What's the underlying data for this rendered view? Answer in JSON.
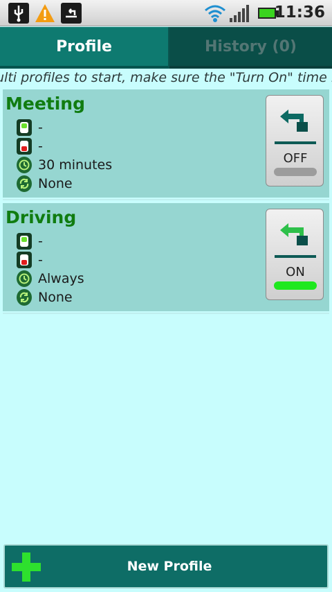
{
  "status_bar": {
    "time": "11:36",
    "icons": [
      "usb-icon",
      "warning-icon",
      "notification-icon",
      "wifi-icon",
      "signal-icon",
      "battery-icon"
    ]
  },
  "tabs": [
    {
      "label": "Profile",
      "active": true
    },
    {
      "label": "History (0)",
      "active": false
    }
  ],
  "ticker": {
    "text": "ulti profiles to start, make sure the \"Turn On\" time n"
  },
  "profiles": [
    {
      "name": "Meeting",
      "start_time": "-",
      "end_time": "-",
      "duration": "30 minutes",
      "repeat": "None",
      "toggle_label": "OFF",
      "enabled": false
    },
    {
      "name": "Driving",
      "start_time": "-",
      "end_time": "-",
      "duration": "Always",
      "repeat": "None",
      "toggle_label": "ON",
      "enabled": true
    }
  ],
  "footer": {
    "new_profile_label": "New Profile"
  },
  "colors": {
    "accent": "#0e7a70",
    "background": "#c8fdfd",
    "card": "#96d6d1",
    "profile_name": "#107c10",
    "on": "#1ee81e",
    "off": "#9c9c9c"
  }
}
